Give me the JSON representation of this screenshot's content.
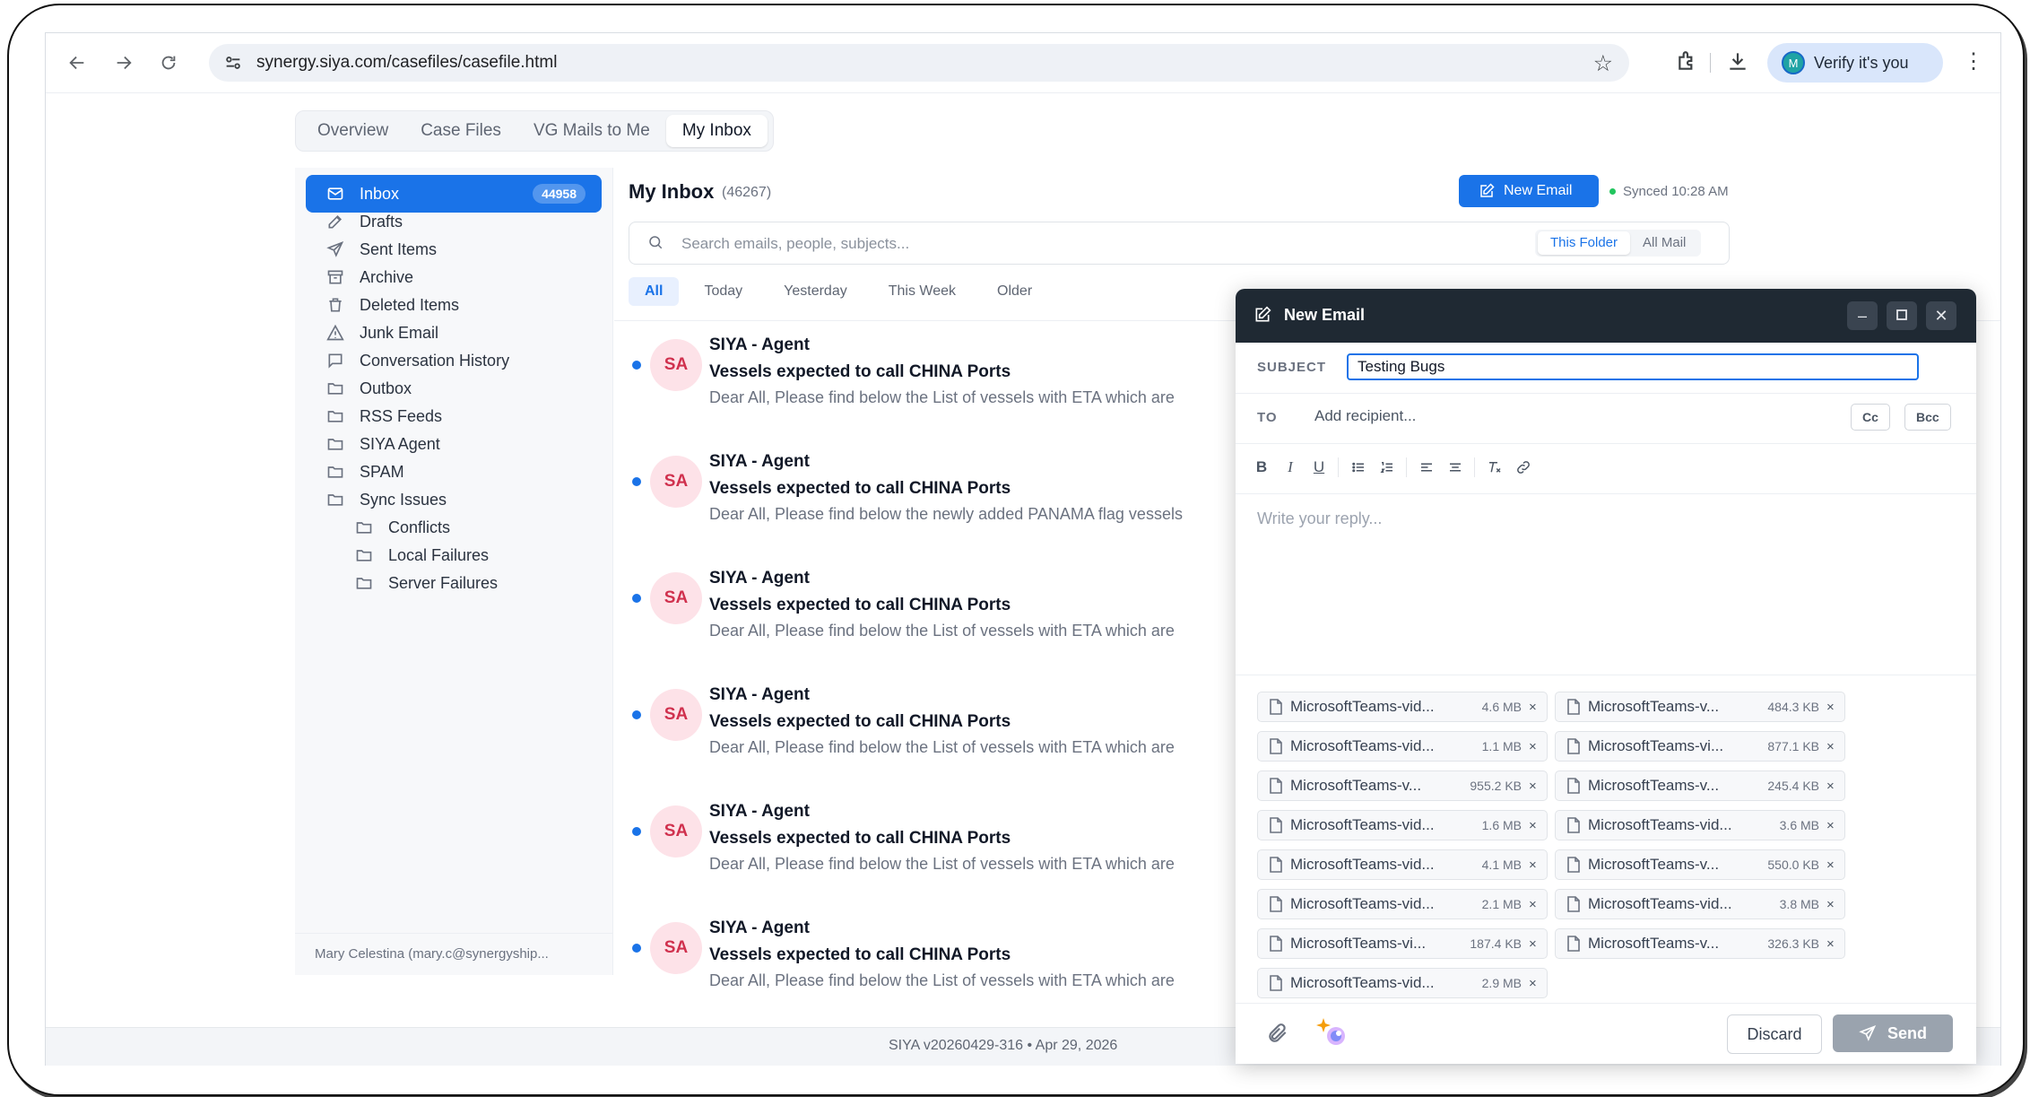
{
  "browser": {
    "url": "synergy.siya.com/casefiles/casefile.html",
    "verify_label": "Verify it's you",
    "profile_initial": "M"
  },
  "tabs": [
    {
      "label": "Overview"
    },
    {
      "label": "Case Files"
    },
    {
      "label": "VG Mails to Me"
    },
    {
      "label": "My Inbox"
    }
  ],
  "sidebar": {
    "items": [
      {
        "label": "Inbox",
        "badge": "44958"
      },
      {
        "label": "Drafts"
      },
      {
        "label": "Sent Items"
      },
      {
        "label": "Archive"
      },
      {
        "label": "Deleted Items"
      },
      {
        "label": "Junk Email"
      },
      {
        "label": "Conversation History"
      },
      {
        "label": "Outbox"
      },
      {
        "label": "RSS Feeds"
      },
      {
        "label": "SIYA Agent"
      },
      {
        "label": "SPAM"
      },
      {
        "label": "Sync Issues"
      },
      {
        "label": "Conflicts"
      },
      {
        "label": "Local Failures"
      },
      {
        "label": "Server Failures"
      }
    ],
    "user": "Mary Celestina (mary.c@synergyship..."
  },
  "main": {
    "title": "My Inbox",
    "count": "(46267)",
    "new_email_label": "New Email",
    "synced": "Synced 10:28 AM",
    "search_placeholder": "Search emails, people, subjects...",
    "scope": [
      "This Folder",
      "All Mail"
    ],
    "filters": [
      "All",
      "Today",
      "Yesterday",
      "This Week",
      "Older"
    ],
    "emails": [
      {
        "initials": "SA",
        "from": "SIYA - Agent",
        "subject": "Vessels expected to call CHINA Ports",
        "preview": "Dear All, Please find below the List of vessels with ETA which are"
      },
      {
        "initials": "SA",
        "from": "SIYA - Agent",
        "subject": "Vessels expected to call CHINA Ports",
        "preview": "Dear All, Please find below the newly added PANAMA flag vessels"
      },
      {
        "initials": "SA",
        "from": "SIYA - Agent",
        "subject": "Vessels expected to call CHINA Ports",
        "preview": "Dear All, Please find below the List of vessels with ETA which are"
      },
      {
        "initials": "SA",
        "from": "SIYA - Agent",
        "subject": "Vessels expected to call CHINA Ports",
        "preview": "Dear All, Please find below the List of vessels with ETA which are"
      },
      {
        "initials": "SA",
        "from": "SIYA - Agent",
        "subject": "Vessels expected to call CHINA Ports",
        "preview": "Dear All, Please find below the List of vessels with ETA which are"
      },
      {
        "initials": "SA",
        "from": "SIYA - Agent",
        "subject": "Vessels expected to call CHINA Ports",
        "preview": "Dear All, Please find below the List of vessels with ETA which are"
      }
    ]
  },
  "footer": {
    "version": "SIYA v20260429-316 • Apr 29, 2026"
  },
  "compose": {
    "title": "New Email",
    "subject_label": "SUBJECT",
    "subject_value": "Testing Bugs",
    "to_label": "TO",
    "to_placeholder": "Add recipient...",
    "cc": "Cc",
    "bcc": "Bcc",
    "body_placeholder": "Write your reply...",
    "attachments": [
      {
        "name": "MicrosoftTeams-vid...",
        "size": "4.6 MB"
      },
      {
        "name": "MicrosoftTeams-v...",
        "size": "484.3 KB"
      },
      {
        "name": "MicrosoftTeams-vid...",
        "size": "1.1 MB"
      },
      {
        "name": "MicrosoftTeams-vi...",
        "size": "877.1 KB"
      },
      {
        "name": "MicrosoftTeams-v...",
        "size": "955.2 KB"
      },
      {
        "name": "MicrosoftTeams-v...",
        "size": "245.4 KB"
      },
      {
        "name": "MicrosoftTeams-vid...",
        "size": "1.6 MB"
      },
      {
        "name": "MicrosoftTeams-vid...",
        "size": "3.6 MB"
      },
      {
        "name": "MicrosoftTeams-vid...",
        "size": "4.1 MB"
      },
      {
        "name": "MicrosoftTeams-v...",
        "size": "550.0 KB"
      },
      {
        "name": "MicrosoftTeams-vid...",
        "size": "2.1 MB"
      },
      {
        "name": "MicrosoftTeams-vid...",
        "size": "3.8 MB"
      },
      {
        "name": "MicrosoftTeams-vi...",
        "size": "187.4 KB"
      },
      {
        "name": "MicrosoftTeams-v...",
        "size": "326.3 KB"
      },
      {
        "name": "MicrosoftTeams-vid...",
        "size": "2.9 MB"
      }
    ],
    "remove_glyph": "×",
    "discard_label": "Discard",
    "send_label": "Send"
  },
  "colors": {
    "accent": "#1a73e8",
    "compose_header": "#1f2933",
    "avatar_bg": "#fde2e8",
    "avatar_text": "#d0314e"
  }
}
